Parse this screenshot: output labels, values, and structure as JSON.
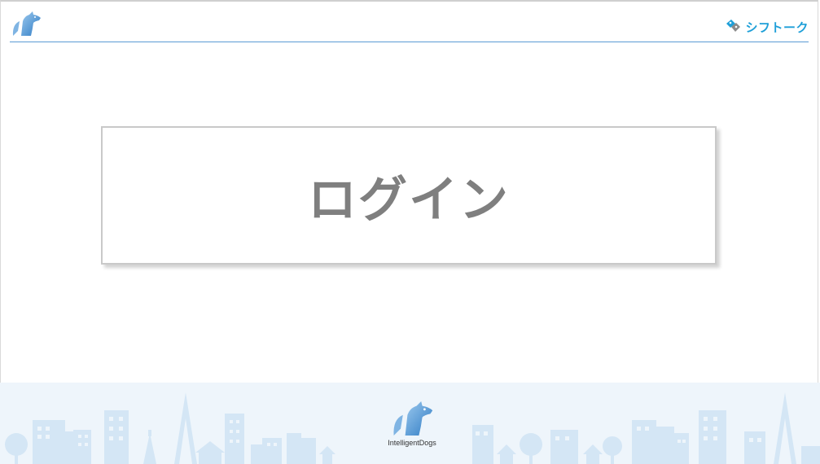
{
  "header": {
    "logo_icon": "wolf-logo-icon",
    "brand": {
      "icon": "tag-chat-icon",
      "name": "シフトーク"
    },
    "accent_color": "#5b9bd5"
  },
  "main": {
    "login_button_label": "ログイン"
  },
  "footer": {
    "logo_icon": "wolf-logo-icon",
    "company_name": "IntelligentDogs",
    "background_color": "#eef5fb"
  }
}
